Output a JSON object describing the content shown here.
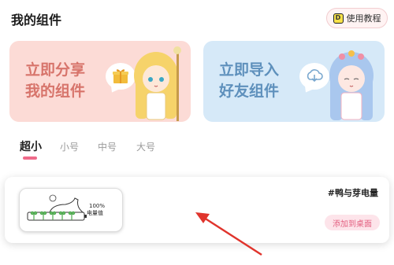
{
  "header": {
    "title": "我的组件",
    "tutorial_label": "使用教程",
    "tutorial_icon_glyph": "D"
  },
  "banners": [
    {
      "line1": "立即分享",
      "line2": "我的组件",
      "icon": "gift-icon",
      "color": "#d7746b"
    },
    {
      "line1": "立即导入",
      "line2": "好友组件",
      "icon": "download-icon",
      "color": "#5e90bc"
    }
  ],
  "size_tabs": [
    {
      "label": "超小",
      "active": true
    },
    {
      "label": "小号",
      "active": false
    },
    {
      "label": "中号",
      "active": false
    },
    {
      "label": "大号",
      "active": false
    }
  ],
  "widget": {
    "name": "#鸭与芽电量",
    "battery_percent": "100%",
    "battery_label": "电量值",
    "add_label": "添加到桌面"
  },
  "colors": {
    "accent": "#ef6a8a",
    "share_bg": "#fcdbd6",
    "import_bg": "#d6e9f8",
    "annotation_arrow": "#e0342c"
  }
}
